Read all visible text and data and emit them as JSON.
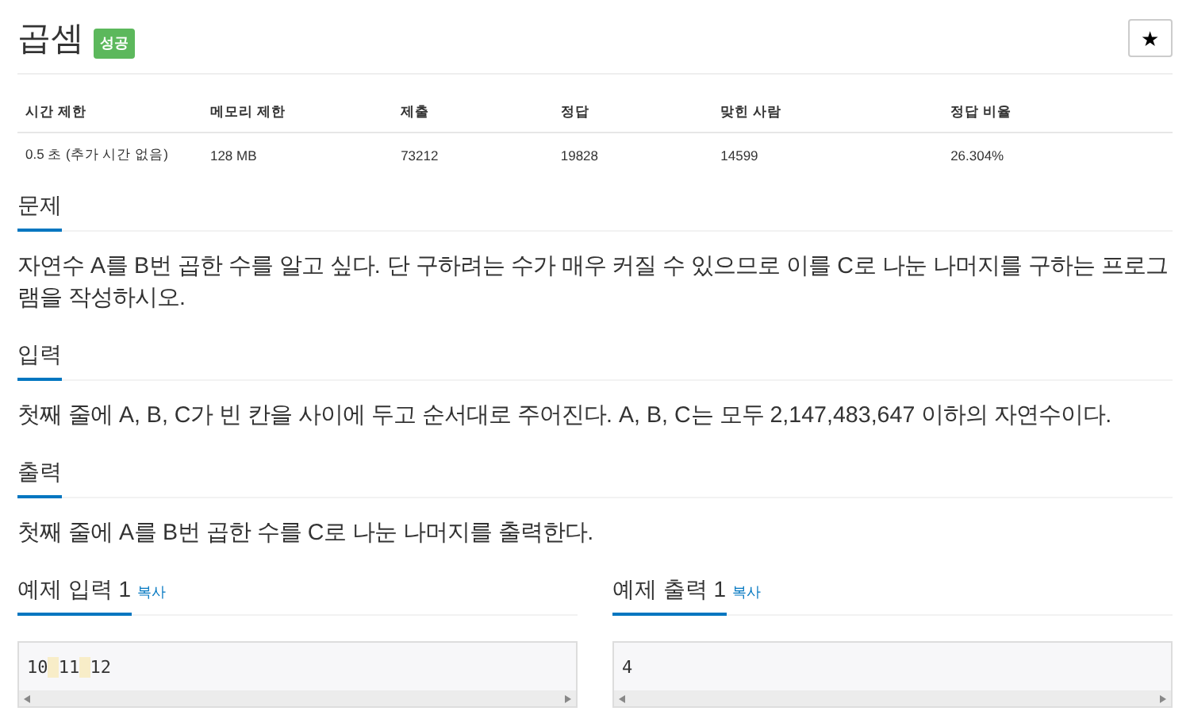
{
  "title": "곱셈",
  "badge": "성공",
  "star": "★",
  "stats": {
    "columns": [
      "시간 제한",
      "메모리 제한",
      "제출",
      "정답",
      "맞힌 사람",
      "정답 비율"
    ],
    "row": [
      "0.5 초 (추가 시간 없음)",
      "128 MB",
      "73212",
      "19828",
      "14599",
      "26.304%"
    ]
  },
  "sections": [
    {
      "heading": "문제",
      "body": "자연수 A를 B번 곱한 수를 알고 싶다. 단 구하려는 수가 매우 커질 수 있으므로 이를 C로 나눈 나머지를 구하는 프로그램을 작성하시오."
    },
    {
      "heading": "입력",
      "body": "첫째 줄에 A, B, C가 빈 칸을 사이에 두고 순서대로 주어진다. A, B, C는 모두 2,147,483,647 이하의 자연수이다."
    },
    {
      "heading": "출력",
      "body": "첫째 줄에 A를 B번 곱한 수를 C로 나눈 나머지를 출력한다."
    }
  ],
  "samples": [
    {
      "heading": "예제 입력 1",
      "copy": "복사",
      "content": "10 11 12"
    },
    {
      "heading": "예제 출력 1",
      "copy": "복사",
      "content": "4"
    }
  ]
}
